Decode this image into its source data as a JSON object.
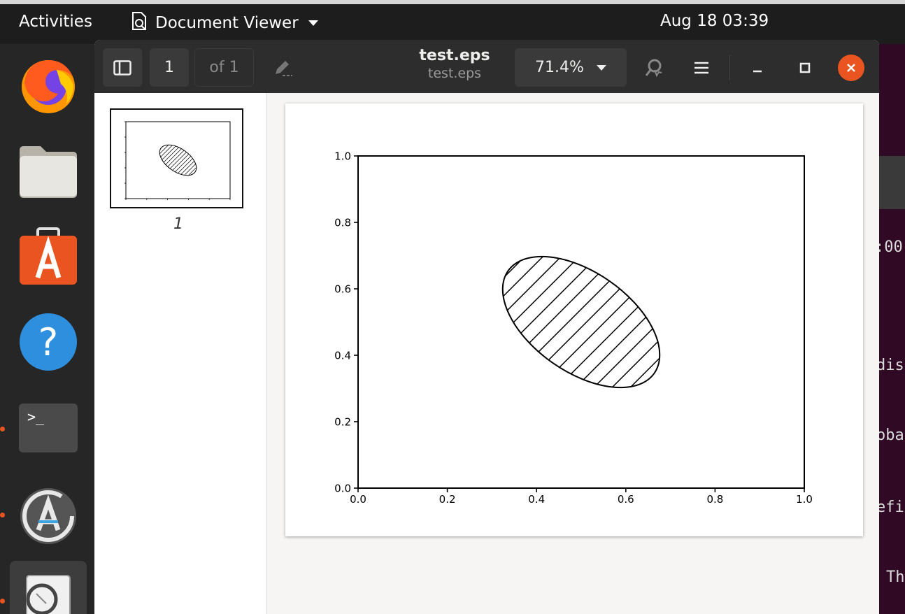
{
  "topbar": {
    "activities": "Activities",
    "app_name": "Document Viewer",
    "clock": "Aug 18  03:39"
  },
  "dock": {
    "items": [
      "firefox-icon",
      "files-icon",
      "software-icon",
      "help-icon",
      "terminal-icon",
      "software-updater-icon",
      "document-viewer-icon"
    ]
  },
  "terminal_fragments": [
    ":00",
    "dis",
    "oba",
    "efi",
    "Th"
  ],
  "toolbar": {
    "page_number": "1",
    "page_of": "of 1",
    "title": "test.eps",
    "subtitle": "test.eps",
    "zoom": "71.4%"
  },
  "sidebar": {
    "thumbnail_label": "1"
  },
  "chart_data": {
    "type": "scatter",
    "title": "",
    "xlabel": "",
    "ylabel": "",
    "xlim": [
      0.0,
      1.0
    ],
    "ylim": [
      0.0,
      1.0
    ],
    "x_ticks": [
      "0.0",
      "0.2",
      "0.4",
      "0.6",
      "0.8",
      "1.0"
    ],
    "y_ticks": [
      "0.0",
      "0.2",
      "0.4",
      "0.6",
      "0.8",
      "1.0"
    ],
    "grid": false,
    "shapes": [
      {
        "kind": "ellipse",
        "center": [
          0.5,
          0.5
        ],
        "width": 0.4,
        "height": 0.3,
        "angle_deg": -35,
        "fill": "none",
        "hatch": "/",
        "edgecolor": "#000000"
      }
    ]
  }
}
